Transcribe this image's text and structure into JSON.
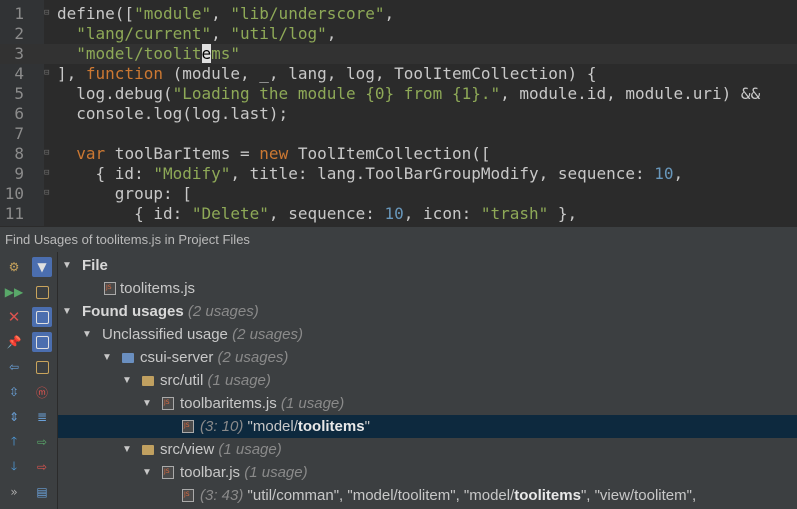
{
  "editor": {
    "lines": [
      {
        "n": "1",
        "tokens": [
          {
            "t": "define([",
            "c": "plain"
          },
          {
            "t": "\"module\"",
            "c": "str"
          },
          {
            "t": ", ",
            "c": "plain"
          },
          {
            "t": "\"lib/underscore\"",
            "c": "str"
          },
          {
            "t": ",",
            "c": "plain"
          }
        ]
      },
      {
        "n": "2",
        "tokens": [
          {
            "t": "  ",
            "c": "plain"
          },
          {
            "t": "\"lang/current\"",
            "c": "str"
          },
          {
            "t": ", ",
            "c": "plain"
          },
          {
            "t": "\"util/log\"",
            "c": "str"
          },
          {
            "t": ",",
            "c": "plain"
          }
        ]
      },
      {
        "n": "3",
        "tokens": [
          {
            "t": "  ",
            "c": "plain"
          },
          {
            "t": "\"model/toolit",
            "c": "str"
          },
          {
            "t": "e",
            "c": "caret"
          },
          {
            "t": "ms\"",
            "c": "str"
          }
        ]
      },
      {
        "n": "4",
        "tokens": [
          {
            "t": "], ",
            "c": "plain"
          },
          {
            "t": "function",
            "c": "kw"
          },
          {
            "t": " (module, _, lang, log, ToolItemCollection) {",
            "c": "plain"
          }
        ]
      },
      {
        "n": "5",
        "tokens": [
          {
            "t": "  log.debug(",
            "c": "plain"
          },
          {
            "t": "\"Loading the module {0} from {1}.\"",
            "c": "str"
          },
          {
            "t": ", module.id, module.uri) &&",
            "c": "plain"
          }
        ]
      },
      {
        "n": "6",
        "tokens": [
          {
            "t": "  console.log(log.last);",
            "c": "plain"
          }
        ]
      },
      {
        "n": "7",
        "tokens": []
      },
      {
        "n": "8",
        "tokens": [
          {
            "t": "  ",
            "c": "plain"
          },
          {
            "t": "var",
            "c": "kw"
          },
          {
            "t": " toolBarItems = ",
            "c": "plain"
          },
          {
            "t": "new",
            "c": "kw"
          },
          {
            "t": " ToolItemCollection([",
            "c": "plain"
          }
        ]
      },
      {
        "n": "9",
        "tokens": [
          {
            "t": "    { id: ",
            "c": "plain"
          },
          {
            "t": "\"Modify\"",
            "c": "str"
          },
          {
            "t": ", title: lang.ToolBarGroupModify, sequence: ",
            "c": "plain"
          },
          {
            "t": "10",
            "c": "num"
          },
          {
            "t": ",",
            "c": "plain"
          }
        ]
      },
      {
        "n": "10",
        "tokens": [
          {
            "t": "      group: [",
            "c": "plain"
          }
        ]
      },
      {
        "n": "11",
        "tokens": [
          {
            "t": "        { id: ",
            "c": "plain"
          },
          {
            "t": "\"Delete\"",
            "c": "str"
          },
          {
            "t": ", sequence: ",
            "c": "plain"
          },
          {
            "t": "10",
            "c": "num"
          },
          {
            "t": ", icon: ",
            "c": "plain"
          },
          {
            "t": "\"trash\"",
            "c": "str"
          },
          {
            "t": " },",
            "c": "plain"
          }
        ]
      }
    ]
  },
  "find": {
    "title": "Find Usages of  toolitems.js in Project Files",
    "file_section": "File",
    "file_name": "toolitems.js",
    "found_label": "Found usages",
    "found_count": "(2 usages)",
    "unclassified_label": "Unclassified usage",
    "unclassified_count": "(2 usages)",
    "module_label": "csui-server",
    "module_count": "(2 usages)",
    "util_dir": "src/util",
    "util_count": "(1 usage)",
    "toolbaritems_file": "toolbaritems.js",
    "toolbaritems_count": "(1 usage)",
    "usage1_loc": "(3: 10)",
    "usage1_pre": "\"model/",
    "usage1_match": "toolitems",
    "usage1_post": "\"",
    "view_dir": "src/view",
    "view_count": "(1 usage)",
    "toolbar_file": "toolbar.js",
    "toolbar_count": "(1 usage)",
    "usage2_loc": "(3: 43)",
    "usage2_pre": "\"util/comman\", \"model/toolitem\", \"model/",
    "usage2_match": "toolitems",
    "usage2_post": "\", \"view/toolitem\","
  },
  "colors": {
    "selection": "#0d293e",
    "string": "#8ea957",
    "keyword": "#cc7832",
    "number": "#6897bb"
  }
}
